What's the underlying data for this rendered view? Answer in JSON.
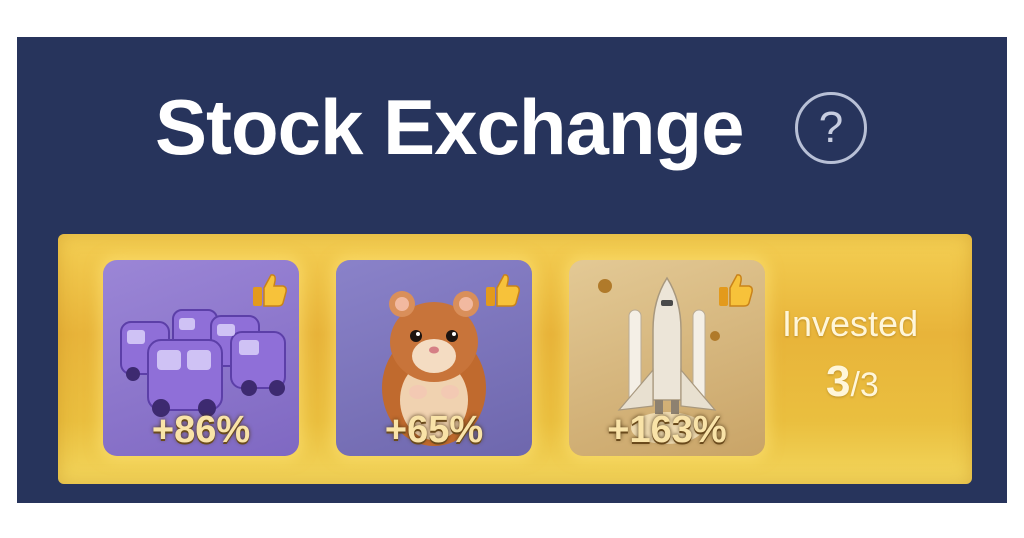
{
  "header": {
    "title": "Stock Exchange",
    "help_icon": "question-circle-icon",
    "help_glyph": "?"
  },
  "cards": [
    {
      "name": "Trucks",
      "icon": "purple-trucks-icon",
      "badge_icon": "thumbs-up-icon",
      "change": "+86%"
    },
    {
      "name": "Hamster",
      "icon": "hamster-icon",
      "badge_icon": "thumbs-up-icon",
      "change": "+65%"
    },
    {
      "name": "Space shuttle",
      "icon": "space-shuttle-icon",
      "badge_icon": "thumbs-up-icon",
      "change": "+163%"
    }
  ],
  "invested": {
    "label": "Invested",
    "current": "3",
    "total": "/3"
  },
  "colors": {
    "panel_bg": "#27345c",
    "strip_gold": "#eabf3f",
    "text_light": "#ffffff"
  }
}
